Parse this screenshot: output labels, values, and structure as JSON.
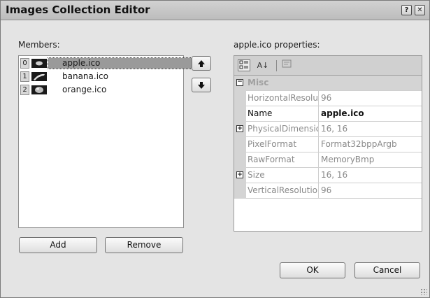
{
  "window": {
    "title": "Images Collection Editor",
    "help_glyph": "?",
    "close_glyph": "✕"
  },
  "members": {
    "label": "Members:",
    "items": [
      {
        "index": "0",
        "name": "apple.ico",
        "selected": true
      },
      {
        "index": "1",
        "name": "banana.ico",
        "selected": false
      },
      {
        "index": "2",
        "name": "orange.ico",
        "selected": false
      }
    ],
    "move_up_glyph": "🡅",
    "move_down_glyph": "🡇",
    "add_label": "Add",
    "remove_label": "Remove"
  },
  "properties": {
    "label": "apple.ico properties:",
    "toolbar": {
      "categorized_icon": "categorized-icon",
      "alphabetical_glyph": "A↓",
      "alphabetical_icon": "alphabetical-sort-icon",
      "pages_icon": "property-pages-icon"
    },
    "category": {
      "expander": "⊟",
      "name": "Misc"
    },
    "rows": [
      {
        "name": "HorizontalResolu",
        "value": "96",
        "expander": "",
        "editable": false
      },
      {
        "name": "Name",
        "value": "apple.ico",
        "expander": "",
        "editable": true
      },
      {
        "name": "PhysicalDimensic",
        "value": "16, 16",
        "expander": "+",
        "editable": false
      },
      {
        "name": "PixelFormat",
        "value": "Format32bppArgb",
        "expander": "",
        "editable": false
      },
      {
        "name": "RawFormat",
        "value": "MemoryBmp",
        "expander": "",
        "editable": false
      },
      {
        "name": "Size",
        "value": "16, 16",
        "expander": "+",
        "editable": false
      },
      {
        "name": "VerticalResolutio",
        "value": "96",
        "expander": "",
        "editable": false
      }
    ]
  },
  "footer": {
    "ok_label": "OK",
    "cancel_label": "Cancel"
  }
}
